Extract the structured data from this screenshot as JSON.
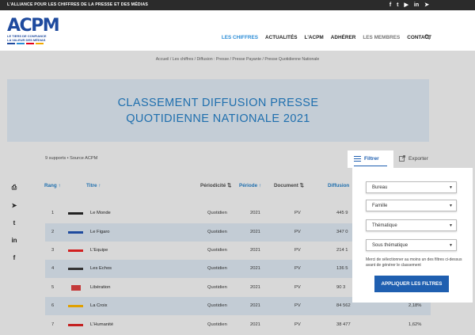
{
  "topbar": {
    "tagline": "L'ALLIANCE POUR LES CHIFFRES DE LA PRESSE ET DES MÉDIAS",
    "socials": [
      {
        "icon": "facebook-icon",
        "glyph": "f"
      },
      {
        "icon": "twitter-icon",
        "glyph": "t"
      },
      {
        "icon": "youtube-icon",
        "glyph": "▶"
      },
      {
        "icon": "linkedin-icon",
        "glyph": "in"
      },
      {
        "icon": "telegram-icon",
        "glyph": "➤"
      }
    ]
  },
  "logo": {
    "text": "ACPM",
    "line1": "LE TIERS DE CONFIANCE",
    "line2": "LA VALEUR DES MÉDIAS"
  },
  "nav": {
    "items": [
      "LES CHIFFRES",
      "ACTUALITÉS",
      "L'ACPM",
      "ADHÉRER",
      "LES MEMBRES",
      "CONTACT"
    ]
  },
  "breadcrumb": "Accueil  /  Les chiffres  /  Diffusion : Presse  /  Presse Payante  /  Presse Quotidienne Nationale",
  "hero": {
    "line1": "CLASSEMENT DIFFUSION PRESSE",
    "line2": "QUOTIDIENNE NATIONALE 2021"
  },
  "meta": "9 supports • Source ACPM",
  "actions": {
    "filter": "Filtrer",
    "export": "Exporter"
  },
  "table": {
    "headers": {
      "rang": "Rang",
      "titre": "Titre",
      "periodicite": "Périodicité",
      "periode": "Période",
      "document": "Document",
      "diffusion": "Diffusion"
    },
    "rows": [
      {
        "rang": "1",
        "titre": "Le Monde",
        "periodicite": "Quotidien",
        "annee": "2021",
        "doc": "PV",
        "diffusion": "445 9",
        "pct": ""
      },
      {
        "rang": "2",
        "titre": "Le Figaro",
        "periodicite": "Quotidien",
        "annee": "2021",
        "doc": "PV",
        "diffusion": "347 0",
        "pct": ""
      },
      {
        "rang": "3",
        "titre": "L'Equipe",
        "periodicite": "Quotidien",
        "annee": "2021",
        "doc": "PV",
        "diffusion": "214 1",
        "pct": ""
      },
      {
        "rang": "4",
        "titre": "Les Echos",
        "periodicite": "Quotidien",
        "annee": "2021",
        "doc": "PV",
        "diffusion": "136 5",
        "pct": ""
      },
      {
        "rang": "5",
        "titre": "Libération",
        "periodicite": "Quotidien",
        "annee": "2021",
        "doc": "PV",
        "diffusion": "90 3",
        "pct": ""
      },
      {
        "rang": "6",
        "titre": "La Croix",
        "periodicite": "Quotidien",
        "annee": "2021",
        "doc": "PV",
        "diffusion": "84 562",
        "pct": "2,18%"
      },
      {
        "rang": "7",
        "titre": "L'Humanité",
        "periodicite": "Quotidien",
        "annee": "2021",
        "doc": "PV",
        "diffusion": "38 477",
        "pct": "1,62%"
      }
    ]
  },
  "filters": {
    "selects": [
      "Bureau",
      "Famille",
      "Thématique",
      "Sous thématique"
    ],
    "note": "Merci de sélectionner au moins un des filtres ci-dessus avant de générer le classement",
    "apply": "APPLIQUER LES FILTRES"
  },
  "colors": {
    "brand": "#1e4a9e",
    "accent": "#1f5fb0",
    "link": "#2a8cd6"
  }
}
